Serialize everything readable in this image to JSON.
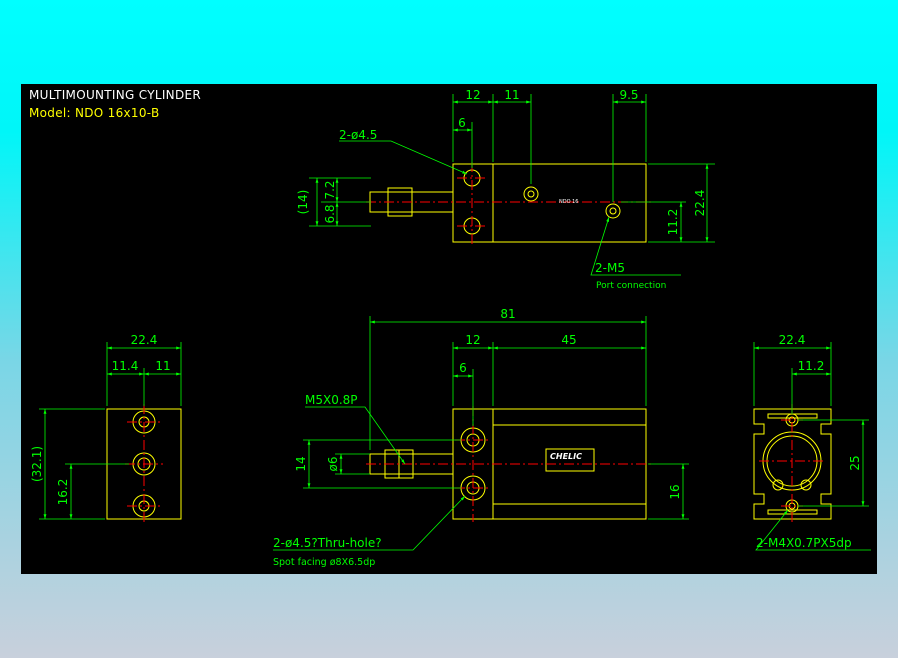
{
  "header": {
    "title": "MULTIMOUNTING CYLINDER",
    "model": "Model: NDO 16x10-B"
  },
  "colors": {
    "background_top": "#00ffff",
    "background_bottom": "#c8d0dc",
    "canvas": "#000000",
    "outline": "#ffff00",
    "dimension": "#00ff00",
    "centerline": "#ff0000",
    "text": "#ffffff"
  },
  "top_view": {
    "dims": {
      "d12": "12",
      "d11": "11",
      "d9_5": "9.5",
      "d6": "6",
      "d14": "(14)",
      "d6_8": "6.8",
      "d7_2": "7.2",
      "d22_4": "22.4",
      "d11_2": "11.2"
    },
    "callout_hole": "2-ø4.5",
    "callout_port": "2-M5",
    "port_note": "Port connection",
    "small_label": "NDO 16"
  },
  "front_view": {
    "dims": {
      "d81": "81",
      "d12": "12",
      "d45": "45",
      "d6": "6",
      "d14": "14",
      "d_phi6": "ø6",
      "d16": "16"
    },
    "callout_thread": "M5X0.8P",
    "callout_hole": "2-ø4.5?Thru-hole?",
    "callout_facing": "Spot facing  ø8X6.5dp",
    "brand": "CHELIC"
  },
  "left_view": {
    "dims": {
      "d22_4": "22.4",
      "d11_4": "11.4",
      "d11": "11",
      "d32_1": "(32.1)",
      "d16_2": "16.2"
    }
  },
  "right_view": {
    "dims": {
      "d22_4": "22.4",
      "d11_2": "11.2",
      "d25": "25"
    },
    "callout": "2-M4X0.7PX5dp"
  }
}
